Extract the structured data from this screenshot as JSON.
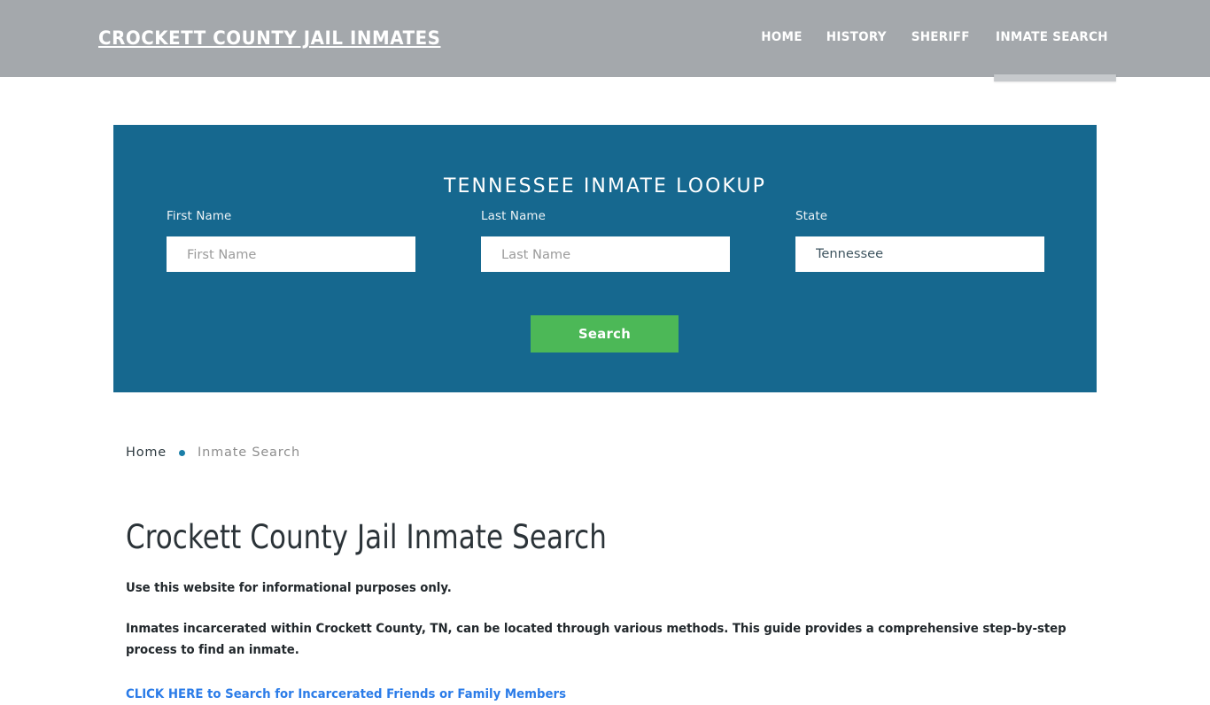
{
  "header": {
    "brand": "CROCKETT COUNTY JAIL INMATES",
    "brand_color": "#ffffff",
    "background_color": "#a4a8ac",
    "nav": [
      {
        "label": "HOME",
        "active": false
      },
      {
        "label": "HISTORY",
        "active": false
      },
      {
        "label": "SHERIFF",
        "active": false
      },
      {
        "label": "INMATE SEARCH",
        "active": true
      }
    ]
  },
  "lookup": {
    "title": "TENNESSEE INMATE LOOKUP",
    "panel_color": "#16688f",
    "fields": {
      "first_name": {
        "label": "First Name",
        "placeholder": "First Name",
        "value": ""
      },
      "last_name": {
        "label": "Last Name",
        "placeholder": "Last Name",
        "value": ""
      },
      "state": {
        "label": "State",
        "value": "Tennessee",
        "options": [
          "Tennessee"
        ]
      }
    },
    "search_button": {
      "label": "Search",
      "color": "#4cb857"
    }
  },
  "breadcrumb": {
    "home": "Home",
    "separator": "bullet",
    "current": "Inmate Search"
  },
  "main": {
    "title": "Crockett County Jail Inmate Search",
    "paragraph_1": "Use this website for informational purposes only.",
    "paragraph_2": "Inmates incarcerated within Crockett County, TN, can be located through various methods. This guide provides a comprehensive step-by-step process to find an inmate.",
    "cta_link": "CLICK HERE to Search for Incarcerated Friends or Family Members",
    "cta_link_color": "#2b7ce8"
  }
}
